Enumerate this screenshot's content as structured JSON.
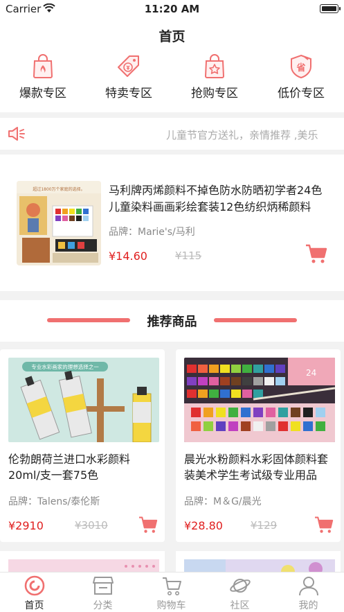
{
  "status_bar": {
    "carrier": "Carrier",
    "time": "11:20 AM"
  },
  "nav": {
    "title": "首页"
  },
  "categories": [
    {
      "label": "爆款专区",
      "icon": "hot-bag-icon"
    },
    {
      "label": "特卖专区",
      "icon": "price-tag-icon"
    },
    {
      "label": "抢购专区",
      "icon": "star-bag-icon"
    },
    {
      "label": "低价专区",
      "icon": "shield-discount-icon"
    }
  ],
  "notice": {
    "text": "儿童节官方送礼，亲情推荐 ,美乐"
  },
  "featured": {
    "name": "马利牌丙烯颜料不掉色防水防晒初学者24色儿童染料画画彩绘套装12色纺织炳稀颜料",
    "brand": "品牌：Marie's/马利",
    "price": "¥14.60",
    "old_price": "¥115",
    "image_text": "超过1800万个家庭的选择。"
  },
  "section": {
    "title": "推荐商品"
  },
  "products": [
    {
      "name": "伦勃朗荷兰进口水彩颜料20ml/支一套75色",
      "brand": "品牌：Talens/泰伦斯",
      "price": "¥2910",
      "old_price": "¥3010",
      "image_text": "专业水彩画家的理想选择之一"
    },
    {
      "name": "晨光水粉颜料水彩固体颜料套装美术学生考试级专业用品",
      "brand": "品牌：M＆G/晨光",
      "price": "¥28.80",
      "old_price": "¥129",
      "image_text": "24"
    }
  ],
  "tabs": [
    {
      "label": "首页",
      "icon": "home-icon",
      "active": true
    },
    {
      "label": "分类",
      "icon": "category-icon",
      "active": false
    },
    {
      "label": "购物车",
      "icon": "cart-icon",
      "active": false
    },
    {
      "label": "社区",
      "icon": "planet-icon",
      "active": false
    },
    {
      "label": "我的",
      "icon": "user-icon",
      "active": false
    }
  ],
  "colors": {
    "accent": "#f07070",
    "price": "#e02020"
  }
}
